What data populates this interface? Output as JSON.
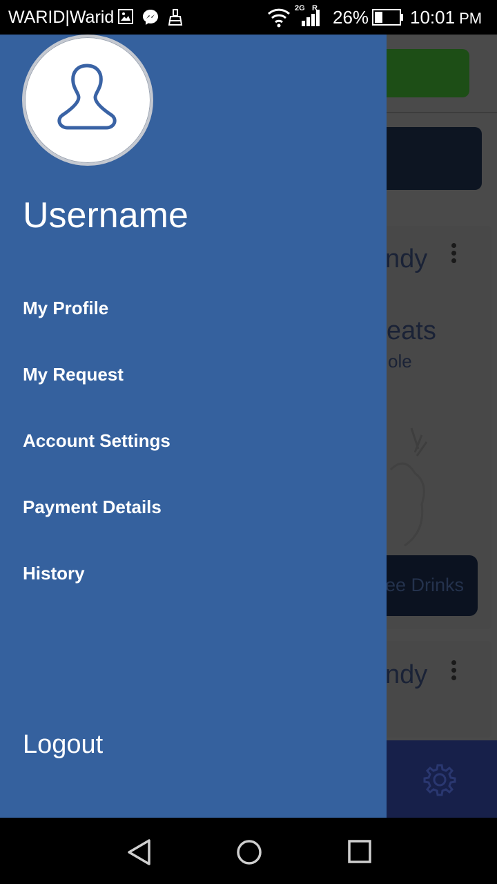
{
  "status_bar": {
    "carrier": "WARID|Warid",
    "network_type": "2G",
    "roaming": "R",
    "battery": "26%",
    "time": "10:01",
    "ampm": "PM",
    "icons": [
      "gallery-icon",
      "messenger-icon",
      "cleaner-icon",
      "wifi-icon",
      "signal-icon",
      "battery-icon"
    ]
  },
  "drawer": {
    "avatar_icon": "user-silhouette-icon",
    "username": "Username",
    "menu": [
      {
        "label": "My Profile"
      },
      {
        "label": "My Request"
      },
      {
        "label": "Account Settings"
      },
      {
        "label": "Payment Details"
      },
      {
        "label": "History"
      }
    ],
    "logout": "Logout",
    "color": "#35619e"
  },
  "background": {
    "card1_title": "ndy",
    "card1_heading": "eats",
    "card1_sub": "ole",
    "card1_button": "ee Drinks",
    "card2_title": "ndy",
    "settings_icon": "gear-icon"
  },
  "system_nav": {
    "back": "back-icon",
    "home": "home-icon",
    "recents": "recents-icon"
  }
}
